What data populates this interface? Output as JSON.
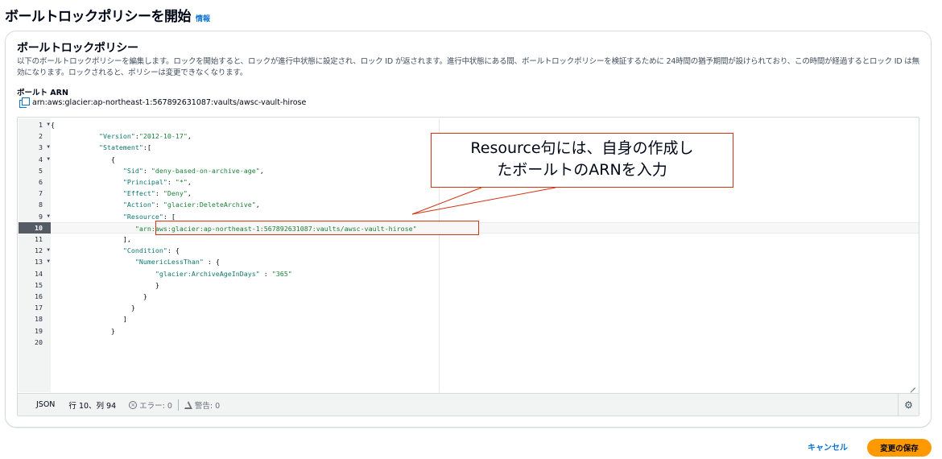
{
  "page": {
    "title": "ボールトロックポリシーを開始",
    "info_link": "情報"
  },
  "section": {
    "title": "ボールトロックポリシー",
    "description": "以下のボールトロックポリシーを編集します。ロックを開始すると、ロックが進行中状態に設定され、ロック ID が返されます。進行中状態にある間、ボールトロックポリシーを検証するために 24時間の猶予期間が設けられており、この時間が経過するとロック ID は無効になります。ロックされると、ポリシーは変更できなくなります。",
    "arn_label": "ボールト ARN",
    "arn_value": "arn:aws:glacier:ap-northeast-1:567892631087:vaults/awsc-vault-hirose"
  },
  "editor": {
    "active_line": 10,
    "lines": [
      {
        "n": "1",
        "fold": true,
        "code": "{"
      },
      {
        "n": "2",
        "fold": false,
        "code": "            \"Version\":\"2012-10-17\","
      },
      {
        "n": "3",
        "fold": true,
        "code": "            \"Statement\":["
      },
      {
        "n": "4",
        "fold": true,
        "code": "               {"
      },
      {
        "n": "5",
        "fold": false,
        "code": "                  \"Sid\": \"deny-based-on-archive-age\","
      },
      {
        "n": "6",
        "fold": false,
        "code": "                  \"Principal\": \"*\","
      },
      {
        "n": "7",
        "fold": false,
        "code": "                  \"Effect\": \"Deny\","
      },
      {
        "n": "8",
        "fold": false,
        "code": "                  \"Action\": \"glacier:DeleteArchive\","
      },
      {
        "n": "9",
        "fold": true,
        "code": "                  \"Resource\": ["
      },
      {
        "n": "10",
        "fold": false,
        "code": "                     \"arn:aws:glacier:ap-northeast-1:567892631087:vaults/awsc-vault-hirose\""
      },
      {
        "n": "11",
        "fold": false,
        "code": "                  ],"
      },
      {
        "n": "12",
        "fold": true,
        "code": "                  \"Condition\": {"
      },
      {
        "n": "13",
        "fold": true,
        "code": "                     \"NumericLessThan\" : {"
      },
      {
        "n": "14",
        "fold": false,
        "code": "                          \"glacier:ArchiveAgeInDays\" : \"365\""
      },
      {
        "n": "15",
        "fold": false,
        "code": "                          }"
      },
      {
        "n": "16",
        "fold": false,
        "code": "                       }"
      },
      {
        "n": "17",
        "fold": false,
        "code": "                    }"
      },
      {
        "n": "18",
        "fold": false,
        "code": "                  ]"
      },
      {
        "n": "19",
        "fold": false,
        "code": "               }"
      },
      {
        "n": "20",
        "fold": false,
        "code": ""
      }
    ],
    "status": {
      "language": "JSON",
      "position": "行 10、列 94",
      "errors": "エラー: 0",
      "warnings": "警告: 0"
    }
  },
  "annotation": {
    "text_line1": "Resource句には、自身の作成し",
    "text_line2": "たボールトのARNを入力",
    "color": "#d13212"
  },
  "footer": {
    "cancel_label": "キャンセル",
    "save_label": "変更の保存",
    "save_color": "#ff9900"
  }
}
